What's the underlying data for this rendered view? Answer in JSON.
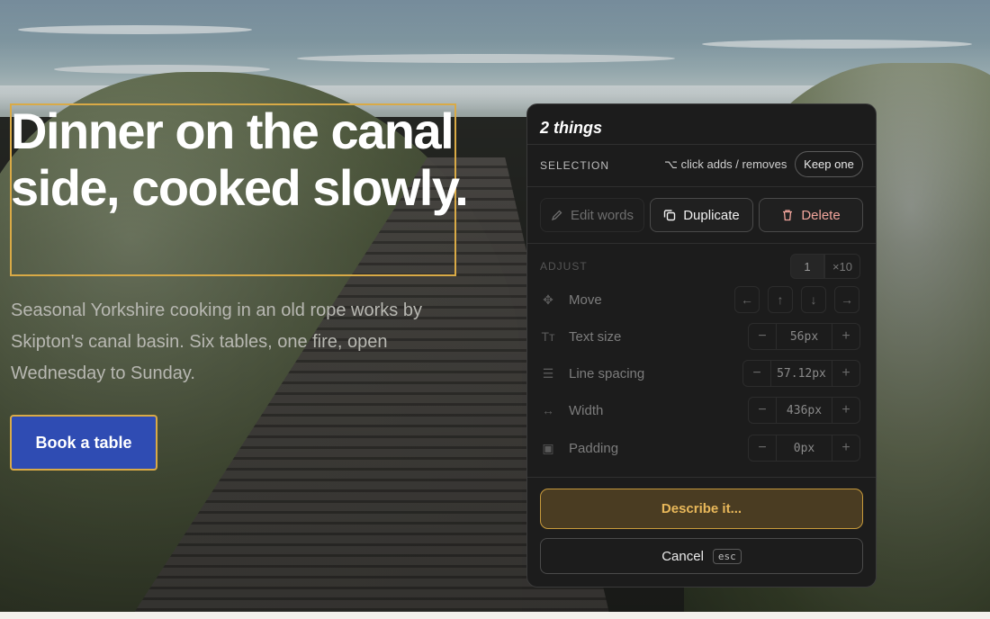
{
  "hero": {
    "title": "Dinner on the canal side, cooked slowly.",
    "subtitle": "Seasonal Yorkshire cooking in an old rope works by Skipton's canal basin. Six tables, one fire, open Wednesday to Sunday.",
    "cta_label": "Book a table"
  },
  "panel": {
    "title": "2 things",
    "selection": {
      "label": "SELECTION",
      "hint": "⌥ click adds / removes",
      "keep_one_label": "Keep one"
    },
    "actions": {
      "edit_words": "Edit words",
      "duplicate": "Duplicate",
      "delete": "Delete"
    },
    "adjust": {
      "label": "ADJUST",
      "step_small": "1",
      "step_large": "×10",
      "move_label": "Move",
      "arrows": [
        "←",
        "↑",
        "↓",
        "→"
      ],
      "rows": [
        {
          "label": "Text size",
          "value": "56px"
        },
        {
          "label": "Line spacing",
          "value": "57.12px"
        },
        {
          "label": "Width",
          "value": "436px"
        },
        {
          "label": "Padding",
          "value": "0px"
        }
      ],
      "minus": "−",
      "plus": "+"
    },
    "describe_label": "Describe it...",
    "cancel_label": "Cancel",
    "cancel_key": "esc"
  },
  "colors": {
    "selection_outline": "#d9aa46",
    "cta_background": "#2f4cb3",
    "panel_background": "#1c1c1c",
    "delete_text": "#f2a59c",
    "describe_accent": "#e9b85a"
  },
  "icons": {
    "edit": "pencil-icon",
    "duplicate": "copy-icon",
    "delete": "trash-icon",
    "move": "move-icon",
    "text_size": "text-size-icon",
    "line_spacing": "line-spacing-icon",
    "width": "width-arrows-icon",
    "padding": "padding-icon"
  }
}
